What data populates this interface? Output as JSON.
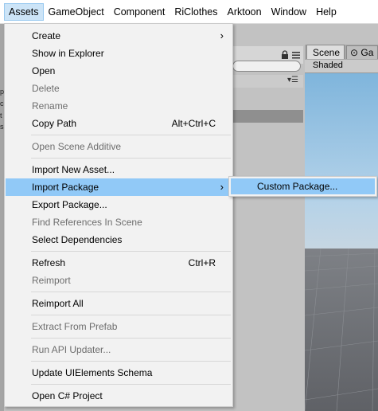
{
  "menubar": {
    "items": [
      {
        "label": "Assets",
        "active": true
      },
      {
        "label": "GameObject"
      },
      {
        "label": "Component"
      },
      {
        "label": "RiClothes"
      },
      {
        "label": "Arktoon"
      },
      {
        "label": "Window"
      },
      {
        "label": "Help"
      }
    ]
  },
  "assets_menu": {
    "items": [
      {
        "label": "Create",
        "submenu": true
      },
      {
        "label": "Show in Explorer"
      },
      {
        "label": "Open"
      },
      {
        "label": "Delete",
        "disabled": true
      },
      {
        "label": "Rename",
        "disabled": true
      },
      {
        "label": "Copy Path",
        "shortcut": "Alt+Ctrl+C"
      },
      {
        "label": "Open Scene Additive",
        "disabled": true
      },
      {
        "label": "Import New Asset..."
      },
      {
        "label": "Import Package",
        "submenu": true,
        "highlighted": true
      },
      {
        "label": "Export Package..."
      },
      {
        "label": "Find References In Scene",
        "disabled": true
      },
      {
        "label": "Select Dependencies"
      },
      {
        "label": "Refresh",
        "shortcut": "Ctrl+R"
      },
      {
        "label": "Reimport",
        "disabled": true
      },
      {
        "label": "Reimport All"
      },
      {
        "label": "Extract From Prefab",
        "disabled": true
      },
      {
        "label": "Run API Updater...",
        "disabled": true
      },
      {
        "label": "Update UIElements Schema"
      },
      {
        "label": "Open C# Project"
      }
    ]
  },
  "import_package_submenu": {
    "items": [
      {
        "label": "Custom Package...",
        "highlighted": true
      }
    ]
  },
  "scene_view": {
    "tab_scene": "Scene",
    "tab_game": "Ga",
    "shading_mode": "Shaded"
  },
  "left_fragments": [
    "p",
    "c",
    "t",
    "s"
  ],
  "colors": {
    "highlight": "#91c9f7",
    "menu_bg": "#f2f2f2",
    "disabled_text": "#6d6d6d",
    "menubar_active": "#cce4f7"
  }
}
